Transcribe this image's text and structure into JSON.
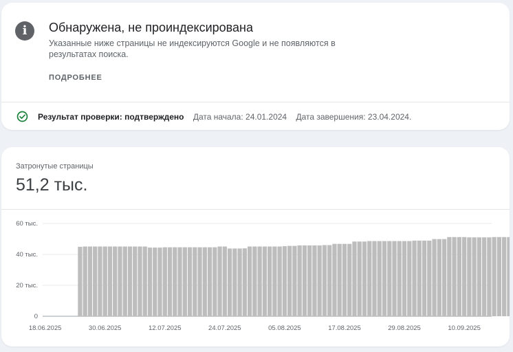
{
  "issue": {
    "title": "Обнаружена, не проиндексирована",
    "description": "Указанные ниже страницы не индексируются Google и не появляются в результатах поиска.",
    "more_link": "ПОДРОБНЕЕ",
    "icon": "info-icon"
  },
  "validation": {
    "icon": "check-circle-icon",
    "label": "Результат проверки: подтверждено",
    "start": "Дата начала: 24.01.2024",
    "end": "Дата завершения: 23.04.2024.",
    "status_color": "#188038"
  },
  "metric": {
    "label": "Затронутые страницы",
    "value": "51,2 тыс."
  },
  "colors": {
    "bar": "#bdbdbd",
    "gridline": "#e8eaed"
  },
  "chart_data": {
    "type": "bar",
    "ylim": [
      0,
      60000
    ],
    "y_ticks": [
      {
        "value": 0,
        "label": "0"
      },
      {
        "value": 20000,
        "label": "20 тыс."
      },
      {
        "value": 40000,
        "label": "40 тыс."
      },
      {
        "value": 60000,
        "label": "60 тыс."
      }
    ],
    "x_tick_labels": [
      "18.06.2025",
      "30.06.2025",
      "12.07.2025",
      "24.07.2025",
      "05.08.2025",
      "17.08.2025",
      "29.08.2025",
      "10.09.2025"
    ],
    "x_tick_categories": [
      0,
      12,
      24,
      36,
      48,
      60,
      72,
      84
    ],
    "categories": [
      "18.06.2025",
      "19.06.2025",
      "20.06.2025",
      "21.06.2025",
      "22.06.2025",
      "23.06.2025",
      "24.06.2025",
      "25.06.2025",
      "26.06.2025",
      "27.06.2025",
      "28.06.2025",
      "29.06.2025",
      "30.06.2025",
      "01.07.2025",
      "02.07.2025",
      "03.07.2025",
      "04.07.2025",
      "05.07.2025",
      "06.07.2025",
      "07.07.2025",
      "08.07.2025",
      "09.07.2025",
      "10.07.2025",
      "11.07.2025",
      "12.07.2025",
      "13.07.2025",
      "14.07.2025",
      "15.07.2025",
      "16.07.2025",
      "17.07.2025",
      "18.07.2025",
      "19.07.2025",
      "20.07.2025",
      "21.07.2025",
      "22.07.2025",
      "23.07.2025",
      "24.07.2025",
      "25.07.2025",
      "26.07.2025",
      "27.07.2025",
      "28.07.2025",
      "29.07.2025",
      "30.07.2025",
      "31.07.2025",
      "01.08.2025",
      "02.08.2025",
      "03.08.2025",
      "04.08.2025",
      "05.08.2025",
      "06.08.2025",
      "07.08.2025",
      "08.08.2025",
      "09.08.2025",
      "10.08.2025",
      "11.08.2025",
      "12.08.2025",
      "13.08.2025",
      "14.08.2025",
      "15.08.2025",
      "16.08.2025",
      "17.08.2025",
      "18.08.2025",
      "19.08.2025",
      "20.08.2025",
      "21.08.2025",
      "22.08.2025",
      "23.08.2025",
      "24.08.2025",
      "25.08.2025",
      "26.08.2025",
      "27.08.2025",
      "28.08.2025",
      "29.08.2025",
      "30.08.2025",
      "31.08.2025",
      "01.09.2025",
      "02.09.2025",
      "03.09.2025",
      "04.09.2025",
      "05.09.2025",
      "06.09.2025",
      "07.09.2025",
      "08.09.2025",
      "09.09.2025",
      "10.09.2025",
      "11.09.2025",
      "12.09.2025",
      "13.09.2025",
      "14.09.2025",
      "15.09.2025"
    ],
    "values": [
      null,
      null,
      null,
      null,
      null,
      null,
      null,
      44900,
      45100,
      45100,
      45100,
      45100,
      45100,
      45100,
      45100,
      45100,
      45100,
      45100,
      45100,
      45100,
      45100,
      44400,
      44400,
      44400,
      44600,
      44600,
      44600,
      44600,
      44600,
      44600,
      44600,
      44600,
      44600,
      44600,
      44600,
      45100,
      45100,
      43800,
      43800,
      43800,
      43900,
      45100,
      45100,
      45100,
      45100,
      45100,
      45100,
      45100,
      45300,
      45500,
      45500,
      45800,
      45800,
      45800,
      45800,
      45800,
      46000,
      46000,
      46800,
      46800,
      46800,
      46800,
      48300,
      48300,
      48300,
      48600,
      48600,
      48600,
      48600,
      48600,
      48600,
      48600,
      48600,
      48600,
      48900,
      48900,
      48900,
      48900,
      49900,
      49900,
      49900,
      51200,
      51200,
      51200,
      51200,
      51000,
      51000,
      51000,
      51000,
      51000,
      51200,
      51200,
      51200,
      51200
    ]
  }
}
